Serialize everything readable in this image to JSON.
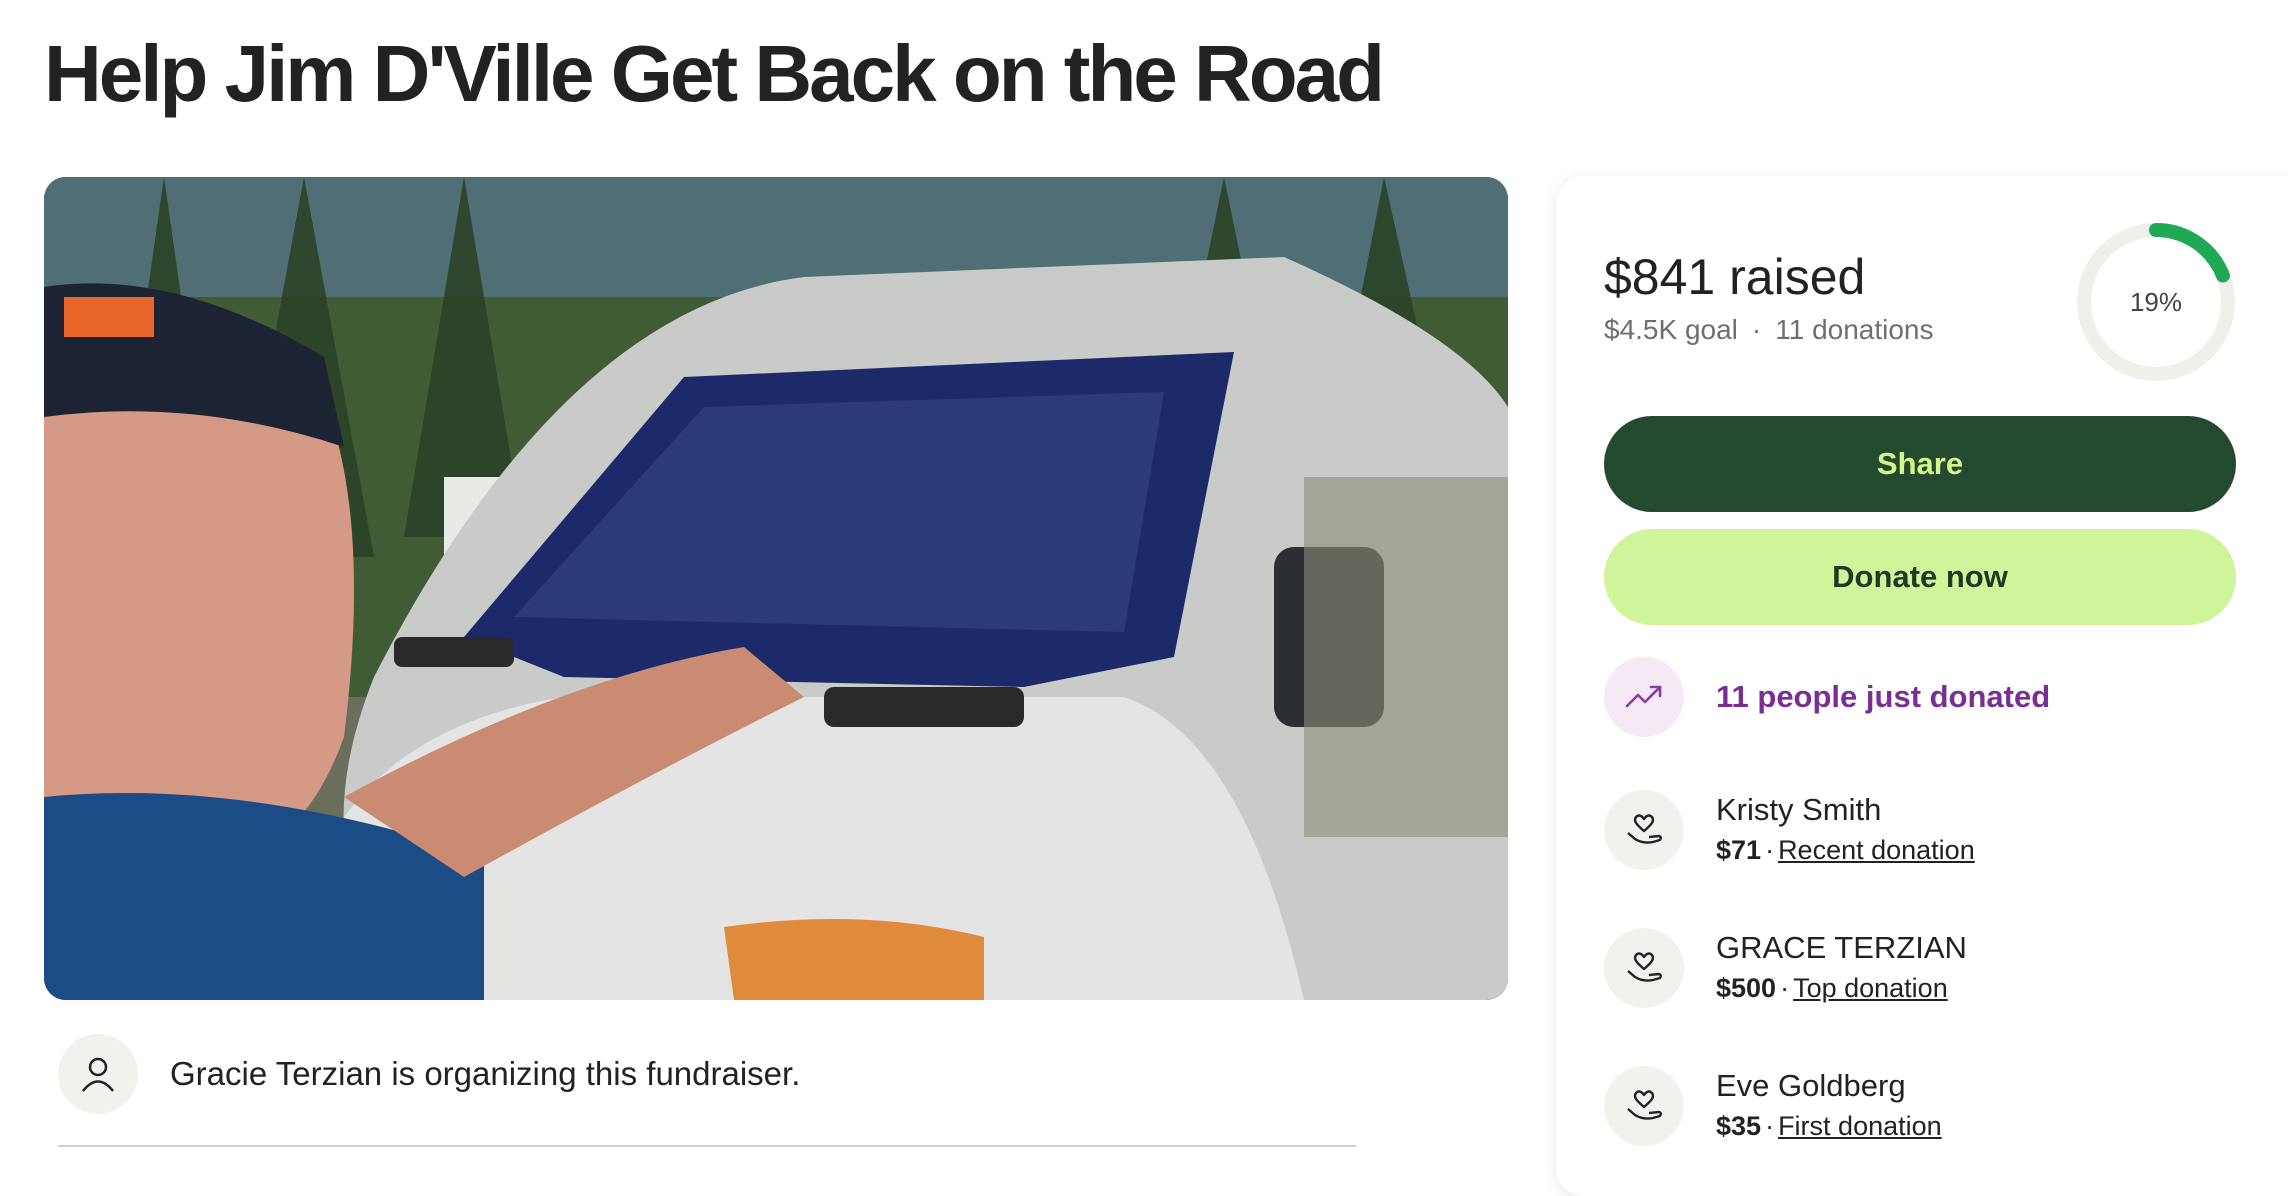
{
  "page": {
    "title": "Help Jim D'Ville Get Back on the Road"
  },
  "organizer": {
    "text": "Gracie Terzian is organizing this fundraiser.",
    "icon": "person-icon"
  },
  "summary": {
    "raised": "$841 raised",
    "goal": "$4.5K goal",
    "separator": "·",
    "donations": "11 donations",
    "progress_label": "19%",
    "progress_fraction": 0.19,
    "progress_color": "#1fa855",
    "track_color": "#f0f0ea"
  },
  "buttons": {
    "share": "Share",
    "donate": "Donate now"
  },
  "trend": {
    "text": "11 people just donated",
    "icon": "trending-up-icon",
    "color": "#7a2e93"
  },
  "donors": [
    {
      "name": "Kristy Smith",
      "amount": "$71",
      "sep": "·",
      "tag": "Recent donation",
      "icon": "heart-hand-icon"
    },
    {
      "name": "GRACE TERZIAN",
      "amount": "$500",
      "sep": "·",
      "tag": "Top donation",
      "icon": "heart-hand-icon"
    },
    {
      "name": "Eve Goldberg",
      "amount": "$35",
      "sep": "·",
      "tag": "First donation",
      "icon": "heart-hand-icon"
    }
  ],
  "colors": {
    "share_bg": "#234a2f",
    "share_text": "#d2f58c",
    "donate_bg": "#cff59a",
    "donate_text": "#1e3a24"
  }
}
